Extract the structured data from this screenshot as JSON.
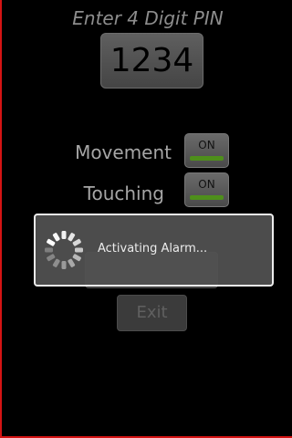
{
  "pin": {
    "title": "Enter 4 Digit PIN",
    "value": "1234"
  },
  "settings": {
    "movement": {
      "label": "Movement",
      "state": "ON"
    },
    "touching": {
      "label": "Touching",
      "state": "ON"
    }
  },
  "buttons": {
    "hidden_label": "",
    "exit_label": "Exit"
  },
  "dialog": {
    "message": "Activating Alarm...",
    "icon": "spinner-icon"
  },
  "colors": {
    "toggle_on": "#4e8f1b",
    "frame_border": "#d41414"
  }
}
